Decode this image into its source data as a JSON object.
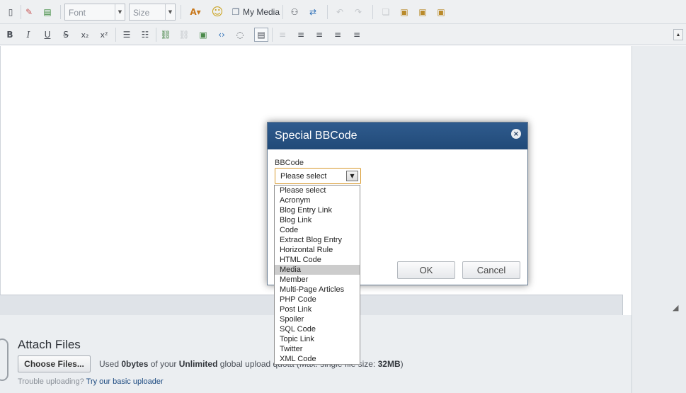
{
  "toolbar": {
    "font_placeholder": "Font",
    "size_placeholder": "Size",
    "my_media_label": "My Media",
    "font_dropdown_icon": "chevron-down-icon"
  },
  "format_toolbar": {
    "bold": "B",
    "italic": "I",
    "underline": "U",
    "strike": "S",
    "subscript": "x₂",
    "superscript": "x²"
  },
  "dialog": {
    "title": "Special BBCode",
    "close_glyph": "×",
    "field_label": "BBCode",
    "selected_value": "Please select",
    "ok_label": "OK",
    "cancel_label": "Cancel",
    "options": [
      "Please select",
      "Acronym",
      "Blog Entry Link",
      "Blog Link",
      "Code",
      "Extract Blog Entry",
      "Horizontal Rule",
      "HTML Code",
      "Media",
      "Member",
      "Multi-Page Articles",
      "PHP Code",
      "Post Link",
      "Spoiler",
      "SQL Code",
      "Topic Link",
      "Twitter",
      "XML Code"
    ],
    "highlighted_option": "Media"
  },
  "attach": {
    "title": "Attach Files",
    "choose_button": "Choose Files...",
    "used_prefix": "Used",
    "used_amount": "0bytes",
    "of_your": "of your",
    "quota_type": "Unlimited",
    "quota_suffix": "global upload quota (Max. single file size:",
    "max_size": "32MB",
    "close_paren": ")",
    "trouble_text": "Trouble uploading?",
    "basic_uploader_link": "Try our basic uploader"
  },
  "colors": {
    "dialog_header": "#2f5b8e",
    "select_focus": "#d89a2e",
    "link": "#1c4a80"
  }
}
